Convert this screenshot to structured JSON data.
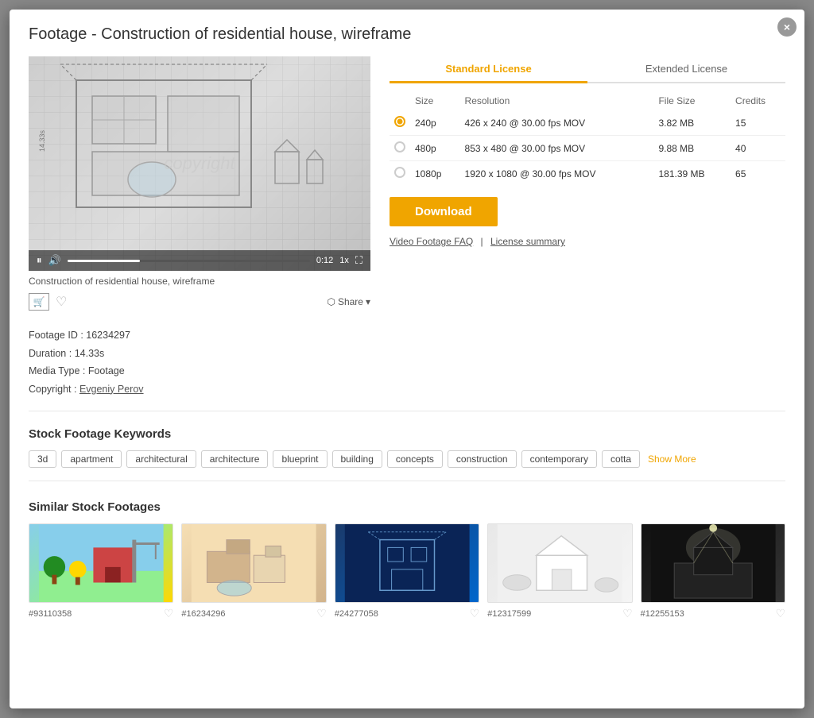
{
  "modal": {
    "title": "Footage - Construction of residential house, wireframe",
    "close_label": "×"
  },
  "video": {
    "caption": "Construction of residential house, wireframe",
    "copyright_watermark": "copyright",
    "time_display": "0:12",
    "speed_label": "1x",
    "controls": {
      "pause_icon": "⏸",
      "volume_icon": "🔊",
      "fullscreen_icon": "⛶"
    }
  },
  "video_actions": {
    "cart_icon": "🛒",
    "heart_icon": "♡",
    "share_label": "Share",
    "share_arrow": "▾"
  },
  "license": {
    "tabs": [
      {
        "label": "Standard License",
        "active": true
      },
      {
        "label": "Extended License",
        "active": false
      }
    ],
    "columns": [
      "Size",
      "Resolution",
      "File Size",
      "Credits"
    ],
    "rows": [
      {
        "size": "240p",
        "resolution": "426 x 240 @ 30.00 fps MOV",
        "file_size": "3.82 MB",
        "credits": "15",
        "selected": true
      },
      {
        "size": "480p",
        "resolution": "853 x 480 @ 30.00 fps MOV",
        "file_size": "9.88 MB",
        "credits": "40",
        "selected": false
      },
      {
        "size": "1080p",
        "resolution": "1920 x 1080 @ 30.00 fps MOV",
        "file_size": "181.39 MB",
        "credits": "65",
        "selected": false
      }
    ],
    "download_label": "Download",
    "links": {
      "faq": "Video Footage FAQ",
      "separator": "|",
      "summary": "License summary"
    }
  },
  "metadata": {
    "footage_id_label": "Footage ID :",
    "footage_id_value": "16234297",
    "duration_label": "Duration :",
    "duration_value": "14.33s",
    "media_type_label": "Media Type :",
    "media_type_value": "Footage",
    "copyright_label": "Copyright :",
    "copyright_value": "Evgeniy Perov"
  },
  "keywords": {
    "section_title": "Stock Footage Keywords",
    "tags": [
      "3d",
      "apartment",
      "architectural",
      "architecture",
      "blueprint",
      "building",
      "concepts",
      "construction",
      "contemporary",
      "cotta"
    ],
    "show_more_label": "Show More"
  },
  "similar": {
    "section_title": "Similar Stock Footages",
    "items": [
      {
        "id": "#93110358",
        "thumb_class": "thumb-1"
      },
      {
        "id": "#16234296",
        "thumb_class": "thumb-2"
      },
      {
        "id": "#24277058",
        "thumb_class": "thumb-3"
      },
      {
        "id": "#12317599",
        "thumb_class": "thumb-4"
      },
      {
        "id": "#12255153",
        "thumb_class": "thumb-5"
      }
    ],
    "heart_icon": "♡"
  }
}
